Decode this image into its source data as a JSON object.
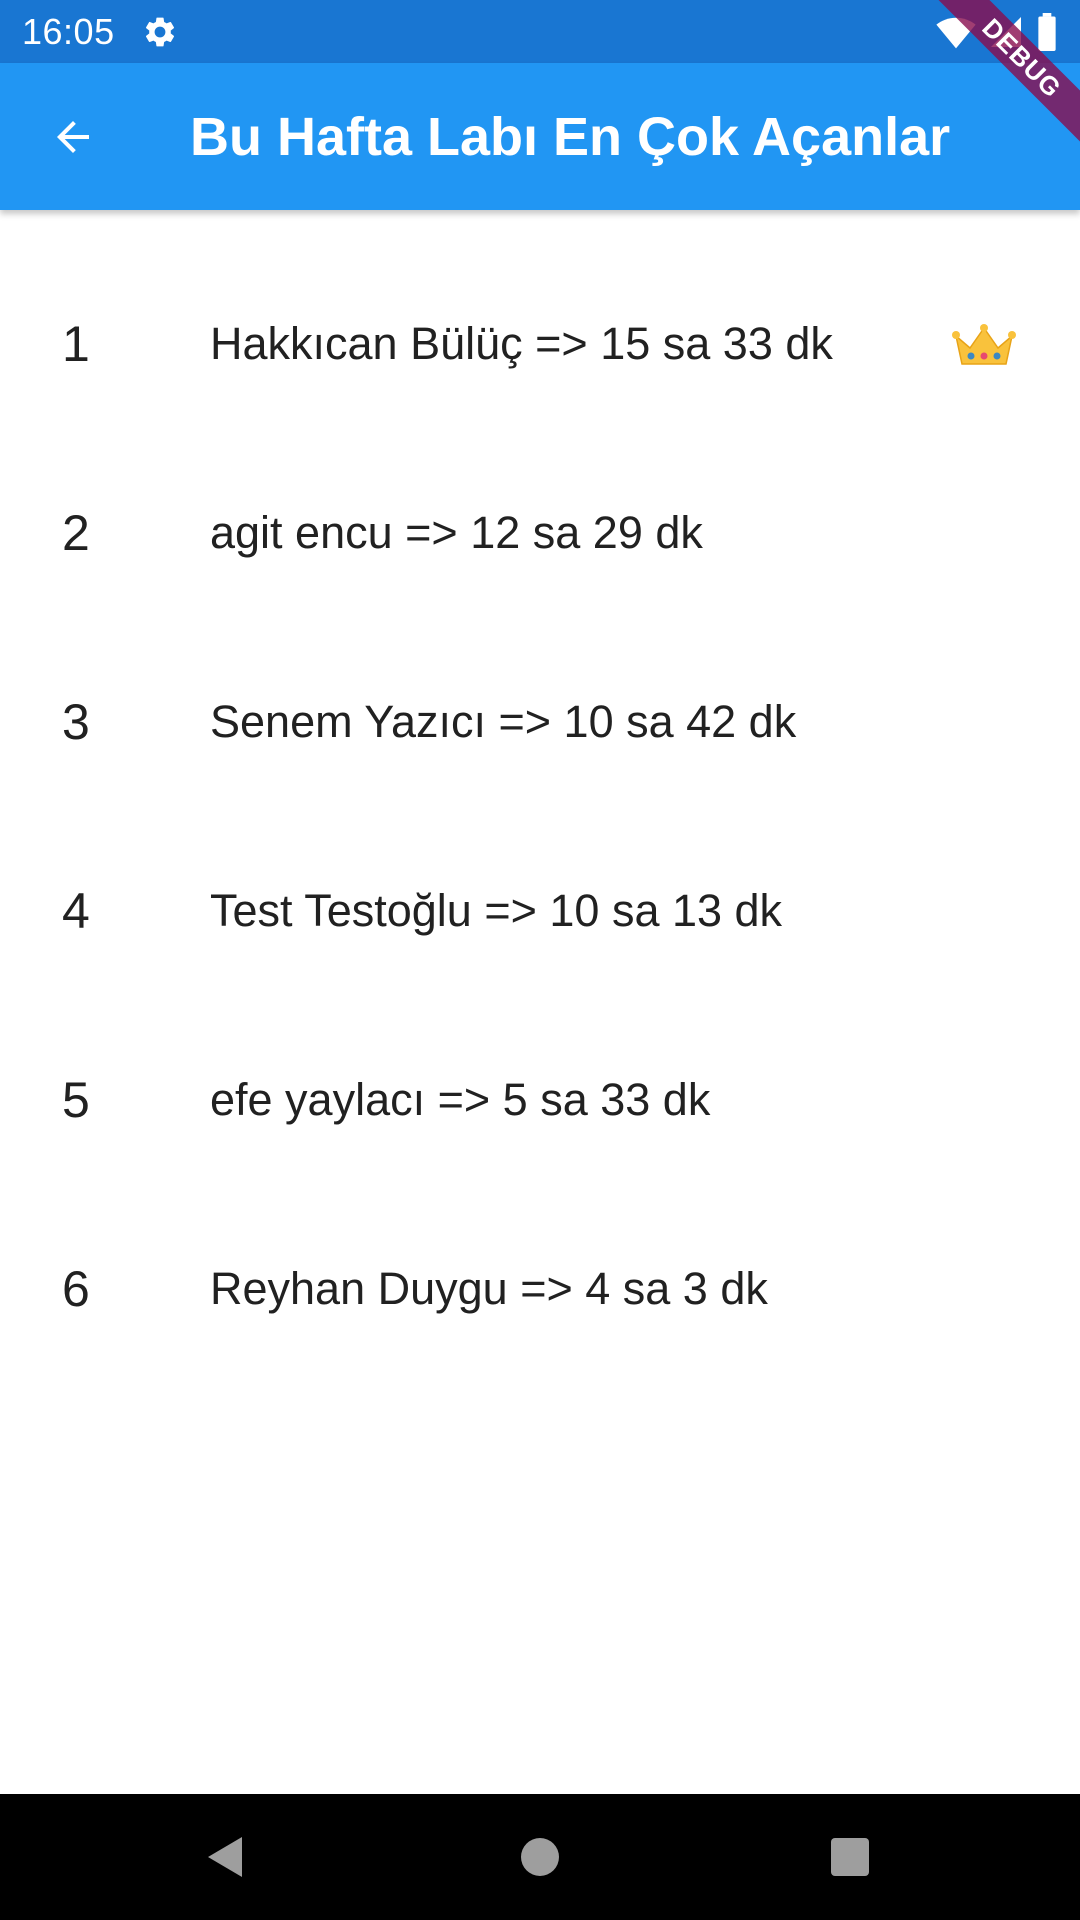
{
  "status_bar": {
    "time": "16:05"
  },
  "app_bar": {
    "title": "Bu Hafta Labı En Çok Açanlar",
    "back_icon": "arrow-back-icon"
  },
  "debug_banner": "DEBUG",
  "leaderboard": [
    {
      "rank": "1",
      "text": "Hakkıcan Bülüç => 15 sa 33 dk",
      "crown": true
    },
    {
      "rank": "2",
      "text": "agit encu => 12 sa 29 dk",
      "crown": false
    },
    {
      "rank": "3",
      "text": "Senem Yazıcı => 10 sa 42 dk",
      "crown": false
    },
    {
      "rank": "4",
      "text": "Test Testoğlu => 10 sa 13 dk",
      "crown": false
    },
    {
      "rank": "5",
      "text": "efe yaylacı => 5 sa 33 dk",
      "crown": false
    },
    {
      "rank": "6",
      "text": "Reyhan Duygu => 4 sa 3 dk",
      "crown": false
    }
  ],
  "colors": {
    "status_bar": "#1976d2",
    "app_bar": "#2196f3",
    "text": "#212121",
    "debug_banner": "#880e4f"
  },
  "icons": {
    "settings": "gear-icon",
    "wifi": "wifi-icon",
    "signal": "signal-icon",
    "battery": "battery-icon",
    "crown": "crown-icon",
    "nav_back": "nav-back-icon",
    "nav_home": "nav-home-icon",
    "nav_recents": "nav-recents-icon"
  }
}
